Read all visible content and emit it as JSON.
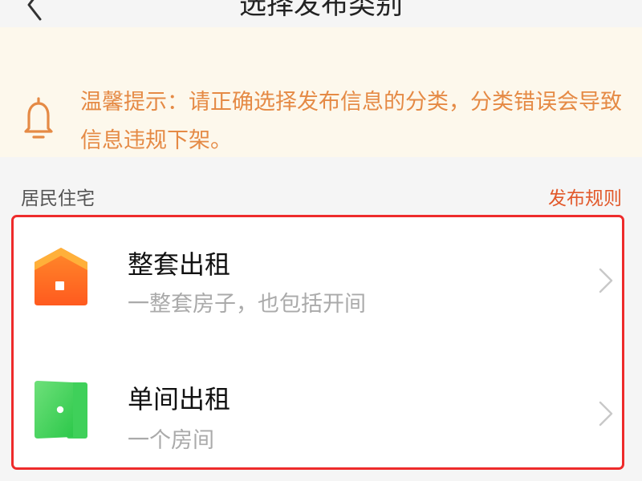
{
  "header": {
    "title": "选择发布类别",
    "back_icon": "chevron-left-icon"
  },
  "notice": {
    "icon": "bell-icon",
    "text": "温馨提示：请正确选择发布信息的分类，分类错误会导致信息违规下架。"
  },
  "section": {
    "label": "居民住宅",
    "rules_link": "发布规则"
  },
  "categories": [
    {
      "title": "整套出租",
      "subtitle": "一整套房子，也包括开间",
      "icon": "house-icon"
    },
    {
      "title": "单间出租",
      "subtitle": "一个房间",
      "icon": "door-icon"
    }
  ],
  "colors": {
    "accent": "#e2592b",
    "notice_text": "#e58a45",
    "notice_bg": "#fdf8ec",
    "highlight_border": "#ee2b2b"
  }
}
